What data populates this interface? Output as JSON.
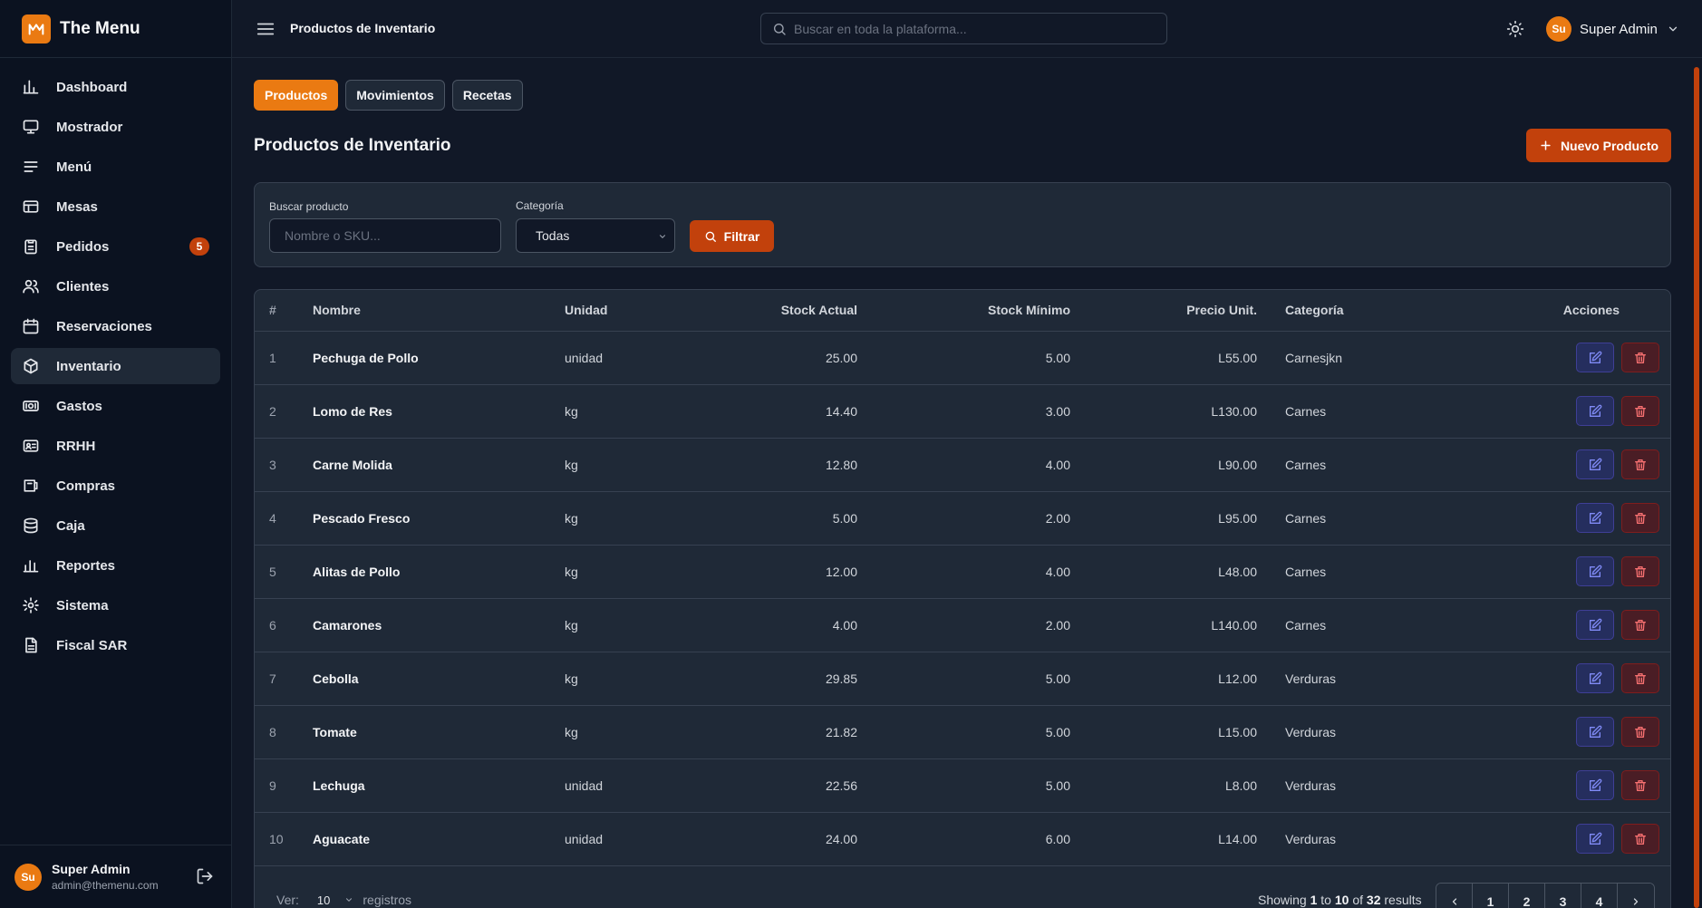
{
  "app": {
    "name": "The Menu"
  },
  "sidebar": {
    "items": [
      {
        "label": "Dashboard",
        "icon": "bar-chart-icon"
      },
      {
        "label": "Mostrador",
        "icon": "monitor-icon"
      },
      {
        "label": "Menú",
        "icon": "menu-lines-icon"
      },
      {
        "label": "Mesas",
        "icon": "table-grid-icon"
      },
      {
        "label": "Pedidos",
        "icon": "clipboard-icon",
        "badge": "5"
      },
      {
        "label": "Clientes",
        "icon": "users-icon"
      },
      {
        "label": "Reservaciones",
        "icon": "calendar-icon"
      },
      {
        "label": "Inventario",
        "icon": "box-icon",
        "active": true
      },
      {
        "label": "Gastos",
        "icon": "money-icon"
      },
      {
        "label": "RRHH",
        "icon": "id-card-icon"
      },
      {
        "label": "Compras",
        "icon": "store-icon"
      },
      {
        "label": "Caja",
        "icon": "database-icon"
      },
      {
        "label": "Reportes",
        "icon": "report-chart-icon"
      },
      {
        "label": "Sistema",
        "icon": "gear-icon"
      },
      {
        "label": "Fiscal SAR",
        "icon": "document-icon"
      }
    ],
    "user": {
      "initials": "Su",
      "name": "Super Admin",
      "email": "admin@themenu.com"
    }
  },
  "topbar": {
    "title": "Productos de Inventario",
    "search_placeholder": "Buscar en toda la plataforma...",
    "user_initials": "Su",
    "user_name": "Super Admin"
  },
  "tabs": [
    "Productos",
    "Movimientos",
    "Recetas"
  ],
  "page": {
    "title": "Productos de Inventario",
    "new_button": "Nuevo Producto"
  },
  "filters": {
    "search_label": "Buscar producto",
    "search_placeholder": "Nombre o SKU...",
    "category_label": "Categoría",
    "category_value": "Todas",
    "filter_button": "Filtrar"
  },
  "table": {
    "columns": [
      "#",
      "Nombre",
      "Unidad",
      "Stock Actual",
      "Stock Mínimo",
      "Precio Unit.",
      "Categoría",
      "Acciones"
    ],
    "rows": [
      [
        "1",
        "Pechuga de Pollo",
        "unidad",
        "25.00",
        "5.00",
        "L55.00",
        "Carnesjkn"
      ],
      [
        "2",
        "Lomo de Res",
        "kg",
        "14.40",
        "3.00",
        "L130.00",
        "Carnes"
      ],
      [
        "3",
        "Carne Molida",
        "kg",
        "12.80",
        "4.00",
        "L90.00",
        "Carnes"
      ],
      [
        "4",
        "Pescado Fresco",
        "kg",
        "5.00",
        "2.00",
        "L95.00",
        "Carnes"
      ],
      [
        "5",
        "Alitas de Pollo",
        "kg",
        "12.00",
        "4.00",
        "L48.00",
        "Carnes"
      ],
      [
        "6",
        "Camarones",
        "kg",
        "4.00",
        "2.00",
        "L140.00",
        "Carnes"
      ],
      [
        "7",
        "Cebolla",
        "kg",
        "29.85",
        "5.00",
        "L12.00",
        "Verduras"
      ],
      [
        "8",
        "Tomate",
        "kg",
        "21.82",
        "5.00",
        "L15.00",
        "Verduras"
      ],
      [
        "9",
        "Lechuga",
        "unidad",
        "22.56",
        "5.00",
        "L8.00",
        "Verduras"
      ],
      [
        "10",
        "Aguacate",
        "unidad",
        "24.00",
        "6.00",
        "L14.00",
        "Verduras"
      ]
    ]
  },
  "footer": {
    "ver_label": "Ver:",
    "per_page": "10",
    "registros": "registros",
    "showing": "Showing",
    "from": "1",
    "to_word": "to",
    "to": "10",
    "of_word": "of",
    "total": "32",
    "results": "results",
    "pages": [
      "1",
      "2",
      "3",
      "4"
    ]
  },
  "colors": {
    "accent": "#ea7a12",
    "accent_dark": "#c2410c",
    "bg": "#111827",
    "panel": "#1f2937",
    "sidebar": "#0b1220"
  }
}
